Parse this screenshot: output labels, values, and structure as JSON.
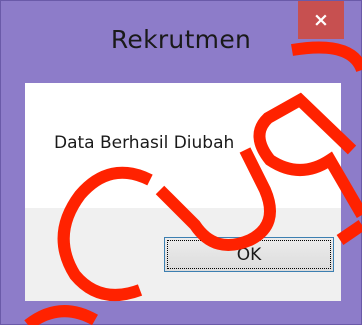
{
  "window": {
    "title": "Rekrutmen",
    "close_glyph": "×",
    "frame_color": "#8d7cc9",
    "close_color": "#c75050"
  },
  "dialog": {
    "message": "Data Berhasil Diubah",
    "ok_label": "OK"
  },
  "icons": {
    "close": "close-icon"
  },
  "watermark": {
    "color": "#ff2200"
  }
}
